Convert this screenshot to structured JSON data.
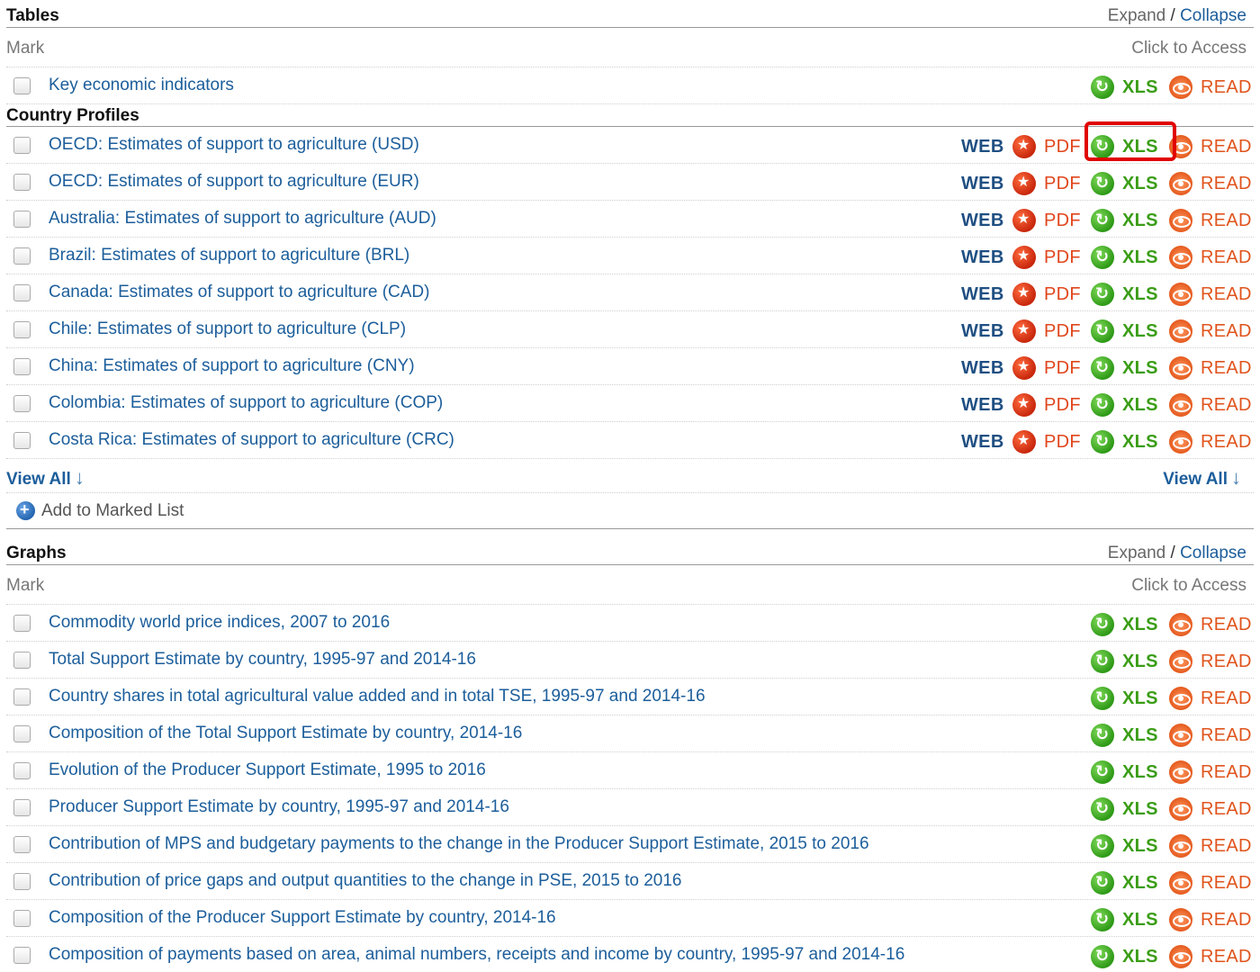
{
  "tables": {
    "heading": "Tables",
    "expand": "Expand",
    "separator": "/",
    "collapse": "Collapse",
    "mark_label": "Mark",
    "click_to_access": "Click to Access",
    "rows": [
      {
        "title": "Key economic indicators",
        "xls": "XLS",
        "read": "READ"
      }
    ]
  },
  "country_profiles": {
    "heading": "Country Profiles",
    "rows": [
      {
        "title": "OECD: Estimates of support to agriculture (USD)",
        "web": "WEB",
        "pdf": "PDF",
        "xls": "XLS",
        "read": "READ",
        "highlighted": "XLS"
      },
      {
        "title": "OECD: Estimates of support to agriculture (EUR)",
        "web": "WEB",
        "pdf": "PDF",
        "xls": "XLS",
        "read": "READ"
      },
      {
        "title": "Australia: Estimates of support to agriculture (AUD)",
        "web": "WEB",
        "pdf": "PDF",
        "xls": "XLS",
        "read": "READ"
      },
      {
        "title": "Brazil: Estimates of support to agriculture (BRL)",
        "web": "WEB",
        "pdf": "PDF",
        "xls": "XLS",
        "read": "READ"
      },
      {
        "title": "Canada: Estimates of support to agriculture (CAD)",
        "web": "WEB",
        "pdf": "PDF",
        "xls": "XLS",
        "read": "READ"
      },
      {
        "title": "Chile: Estimates of support to agriculture (CLP)",
        "web": "WEB",
        "pdf": "PDF",
        "xls": "XLS",
        "read": "READ"
      },
      {
        "title": "China: Estimates of support to agriculture (CNY)",
        "web": "WEB",
        "pdf": "PDF",
        "xls": "XLS",
        "read": "READ"
      },
      {
        "title": "Colombia: Estimates of support to agriculture (COP)",
        "web": "WEB",
        "pdf": "PDF",
        "xls": "XLS",
        "read": "READ"
      },
      {
        "title": "Costa Rica: Estimates of support to agriculture (CRC)",
        "web": "WEB",
        "pdf": "PDF",
        "xls": "XLS",
        "read": "READ"
      }
    ],
    "view_all": "View All",
    "view_all_arrow": "↓",
    "add_to_marked_list": "Add to Marked List"
  },
  "graphs": {
    "heading": "Graphs",
    "expand": "Expand",
    "separator": "/",
    "collapse": "Collapse",
    "mark_label": "Mark",
    "click_to_access": "Click to Access",
    "rows": [
      {
        "title": "Commodity world price indices, 2007 to 2016",
        "xls": "XLS",
        "read": "READ"
      },
      {
        "title": "Total Support Estimate by country, 1995-97 and 2014-16",
        "xls": "XLS",
        "read": "READ"
      },
      {
        "title": "Country shares in total agricultural value added and in total TSE, 1995-97 and 2014-16",
        "xls": "XLS",
        "read": "READ"
      },
      {
        "title": "Composition of the Total Support Estimate by country, 2014-16",
        "xls": "XLS",
        "read": "READ"
      },
      {
        "title": "Evolution of the Producer Support Estimate, 1995 to 2016",
        "xls": "XLS",
        "read": "READ"
      },
      {
        "title": "Producer Support Estimate by country, 1995-97 and 2014-16",
        "xls": "XLS",
        "read": "READ"
      },
      {
        "title": "Contribution of MPS and budgetary payments to the change in the Producer Support Estimate, 2015 to 2016",
        "xls": "XLS",
        "read": "READ"
      },
      {
        "title": "Contribution of price gaps and output quantities to the change in PSE, 2015 to 2016",
        "xls": "XLS",
        "read": "READ"
      },
      {
        "title": "Composition of the Producer Support Estimate by country, 2014-16",
        "xls": "XLS",
        "read": "READ"
      },
      {
        "title": "Composition of payments based on area, animal numbers, receipts and income by country, 1995-97 and 2014-16",
        "xls": "XLS",
        "read": "READ"
      }
    ]
  },
  "colors": {
    "link": "#1c5e9b",
    "xls": "#3a9d16",
    "read": "#e0541d",
    "pdf": "#e0461c",
    "web": "#1f4f82",
    "highlight": "#e00000"
  },
  "icons": {
    "web": "globe-icon",
    "pdf": "pdf-icon",
    "xls": "xls-icon",
    "read": "read-eye-icon",
    "add": "plus-circle-icon"
  }
}
